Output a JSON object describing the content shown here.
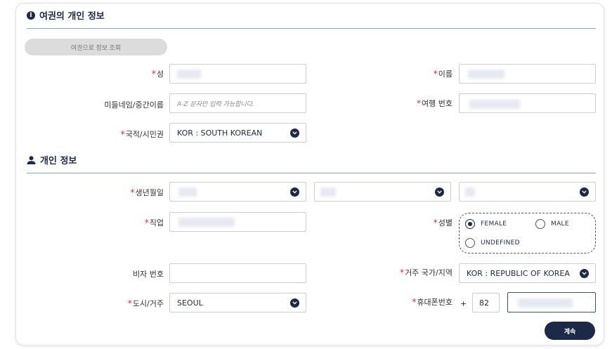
{
  "passport_section": {
    "title": "여권의 개인 정보",
    "lookup_button": "여권으로 정보 조회",
    "surname_label": "성",
    "given_name_label": "이름",
    "middle_name_label": "미들네임/중간이름",
    "middle_name_placeholder": "A-Z 문자만 입력 가능합니다.",
    "passport_no_label": "여행 번호",
    "nationality_label": "국적/시민권",
    "nationality_value": "KOR : SOUTH KOREAN"
  },
  "personal_section": {
    "title": "개인 정보",
    "dob_label": "생년월일",
    "occupation_label": "직업",
    "gender_label": "성별",
    "gender_options": [
      "FEMALE",
      "MALE",
      "UNDEFINED"
    ],
    "gender_selected": "FEMALE",
    "visa_no_label": "비자 번호",
    "residence_country_label": "거주 국가/지역",
    "residence_country_value": "KOR : REPUBLIC OF KOREA",
    "city_label": "도시/거주",
    "city_value": "SEOUL",
    "mobile_label": "휴대폰번호",
    "mobile_plus": "+",
    "mobile_country_code": "82"
  },
  "actions": {
    "continue_label": "계속"
  },
  "colors": {
    "accent": "#1c2a48",
    "required": "#e0262f",
    "divider": "#7fa6cf"
  }
}
